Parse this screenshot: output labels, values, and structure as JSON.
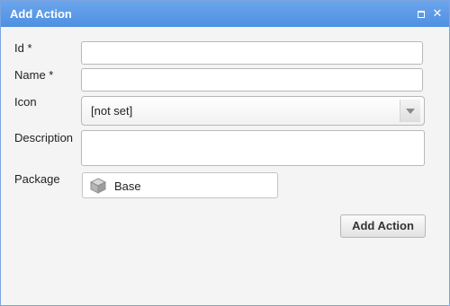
{
  "window": {
    "title": "Add Action"
  },
  "form": {
    "id_label": "Id *",
    "id_value": "",
    "name_label": "Name *",
    "name_value": "",
    "icon_label": "Icon",
    "icon_selected": "[not set]",
    "description_label": "Description",
    "description_value": "",
    "package_label": "Package",
    "package_value": "Base",
    "package_icon": "package-cube-icon"
  },
  "actions": {
    "submit_label": "Add Action"
  },
  "colors": {
    "titlebar": "#5a99e6",
    "background": "#f4f4f4"
  }
}
